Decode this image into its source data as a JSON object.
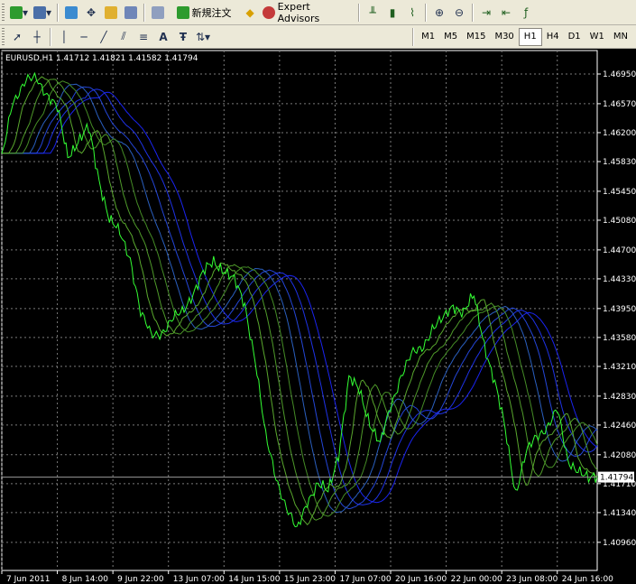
{
  "toolbar": {
    "new_order_label": "新規注文",
    "expert_advisors_label": "Expert Advisors"
  },
  "timeframes": [
    "M1",
    "M5",
    "M15",
    "M30",
    "H1",
    "H4",
    "D1",
    "W1",
    "MN"
  ],
  "active_timeframe": "H1",
  "chart_header": "EURUSD,H1  1.41712 1.41821 1.41582 1.41794",
  "current_price_label": "1.41794",
  "colors": {
    "background": "#000000",
    "grid": "#7a7a7a",
    "price_line": "#33ff33",
    "ma_fast": "#4fa02a",
    "ma_slow": "#2020dd",
    "toolbar_bg": "#ece9d8"
  },
  "chart_data": {
    "type": "line",
    "symbol": "EURUSD",
    "timeframe": "H1",
    "ohlc_last": {
      "open": 1.41712,
      "high": 1.41821,
      "low": 1.41582,
      "close": 1.41794
    },
    "ylim": [
      1.406,
      1.4725
    ],
    "y_ticks": [
      "1.46950",
      "1.46570",
      "1.46200",
      "1.45830",
      "1.45450",
      "1.45080",
      "1.44700",
      "1.44330",
      "1.43950",
      "1.43580",
      "1.43210",
      "1.42830",
      "1.42460",
      "1.42080",
      "1.41710",
      "1.41340",
      "1.40960"
    ],
    "y_tick_values": [
      1.4695,
      1.4657,
      1.462,
      1.4583,
      1.4545,
      1.4508,
      1.447,
      1.4433,
      1.4395,
      1.4358,
      1.4321,
      1.4283,
      1.4246,
      1.4208,
      1.4171,
      1.4134,
      1.4096
    ],
    "x_tick_labels": [
      "7 Jun 2011",
      "8 Jun 14:00",
      "9 Jun 22:00",
      "13 Jun 07:00",
      "14 Jun 15:00",
      "15 Jun 23:00",
      "17 Jun 07:00",
      "20 Jun 16:00",
      "22 Jun 00:00",
      "23 Jun 08:00",
      "24 Jun 16:00"
    ],
    "x_count": 344,
    "x_tick_index": [
      0,
      32,
      64,
      96,
      128,
      160,
      192,
      224,
      256,
      288,
      320
    ],
    "grid": true,
    "price_series": [
      {
        "x": 0,
        "y": 1.4585
      },
      {
        "x": 6,
        "y": 1.466
      },
      {
        "x": 14,
        "y": 1.4685
      },
      {
        "x": 20,
        "y": 1.469
      },
      {
        "x": 26,
        "y": 1.467
      },
      {
        "x": 32,
        "y": 1.465
      },
      {
        "x": 38,
        "y": 1.459
      },
      {
        "x": 44,
        "y": 1.461
      },
      {
        "x": 50,
        "y": 1.4625
      },
      {
        "x": 56,
        "y": 1.456
      },
      {
        "x": 62,
        "y": 1.451
      },
      {
        "x": 68,
        "y": 1.449
      },
      {
        "x": 74,
        "y": 1.446
      },
      {
        "x": 80,
        "y": 1.439
      },
      {
        "x": 86,
        "y": 1.436
      },
      {
        "x": 92,
        "y": 1.4365
      },
      {
        "x": 98,
        "y": 1.438
      },
      {
        "x": 104,
        "y": 1.439
      },
      {
        "x": 110,
        "y": 1.4415
      },
      {
        "x": 116,
        "y": 1.444
      },
      {
        "x": 122,
        "y": 1.4455
      },
      {
        "x": 128,
        "y": 1.4445
      },
      {
        "x": 134,
        "y": 1.443
      },
      {
        "x": 140,
        "y": 1.44
      },
      {
        "x": 146,
        "y": 1.433
      },
      {
        "x": 152,
        "y": 1.423
      },
      {
        "x": 158,
        "y": 1.418
      },
      {
        "x": 164,
        "y": 1.414
      },
      {
        "x": 170,
        "y": 1.411
      },
      {
        "x": 176,
        "y": 1.415
      },
      {
        "x": 182,
        "y": 1.417
      },
      {
        "x": 188,
        "y": 1.416
      },
      {
        "x": 194,
        "y": 1.421
      },
      {
        "x": 200,
        "y": 1.4305
      },
      {
        "x": 206,
        "y": 1.429
      },
      {
        "x": 212,
        "y": 1.425
      },
      {
        "x": 218,
        "y": 1.422
      },
      {
        "x": 224,
        "y": 1.427
      },
      {
        "x": 230,
        "y": 1.431
      },
      {
        "x": 236,
        "y": 1.4335
      },
      {
        "x": 242,
        "y": 1.4345
      },
      {
        "x": 248,
        "y": 1.437
      },
      {
        "x": 254,
        "y": 1.438
      },
      {
        "x": 260,
        "y": 1.44
      },
      {
        "x": 266,
        "y": 1.439
      },
      {
        "x": 272,
        "y": 1.441
      },
      {
        "x": 278,
        "y": 1.435
      },
      {
        "x": 284,
        "y": 1.43
      },
      {
        "x": 290,
        "y": 1.424
      },
      {
        "x": 296,
        "y": 1.416
      },
      {
        "x": 302,
        "y": 1.421
      },
      {
        "x": 308,
        "y": 1.423
      },
      {
        "x": 314,
        "y": 1.4245
      },
      {
        "x": 320,
        "y": 1.4265
      },
      {
        "x": 326,
        "y": 1.42
      },
      {
        "x": 332,
        "y": 1.419
      },
      {
        "x": 338,
        "y": 1.4175
      },
      {
        "x": 343,
        "y": 1.41794
      }
    ],
    "ma_series": [
      {
        "offset": 0.0,
        "lag": 4,
        "color": "#5aa82e"
      },
      {
        "offset": 0.0006,
        "lag": 8,
        "color": "#4f9a2a"
      },
      {
        "offset": 0.0012,
        "lag": 12,
        "color": "#458c26"
      },
      {
        "offset": 0.0018,
        "lag": 16,
        "color": "#2a5fbf"
      },
      {
        "offset": 0.0024,
        "lag": 20,
        "color": "#2446d8"
      },
      {
        "offset": 0.003,
        "lag": 24,
        "color": "#1e32e6"
      },
      {
        "offset": 0.0036,
        "lag": 28,
        "color": "#1a24f0"
      }
    ]
  }
}
